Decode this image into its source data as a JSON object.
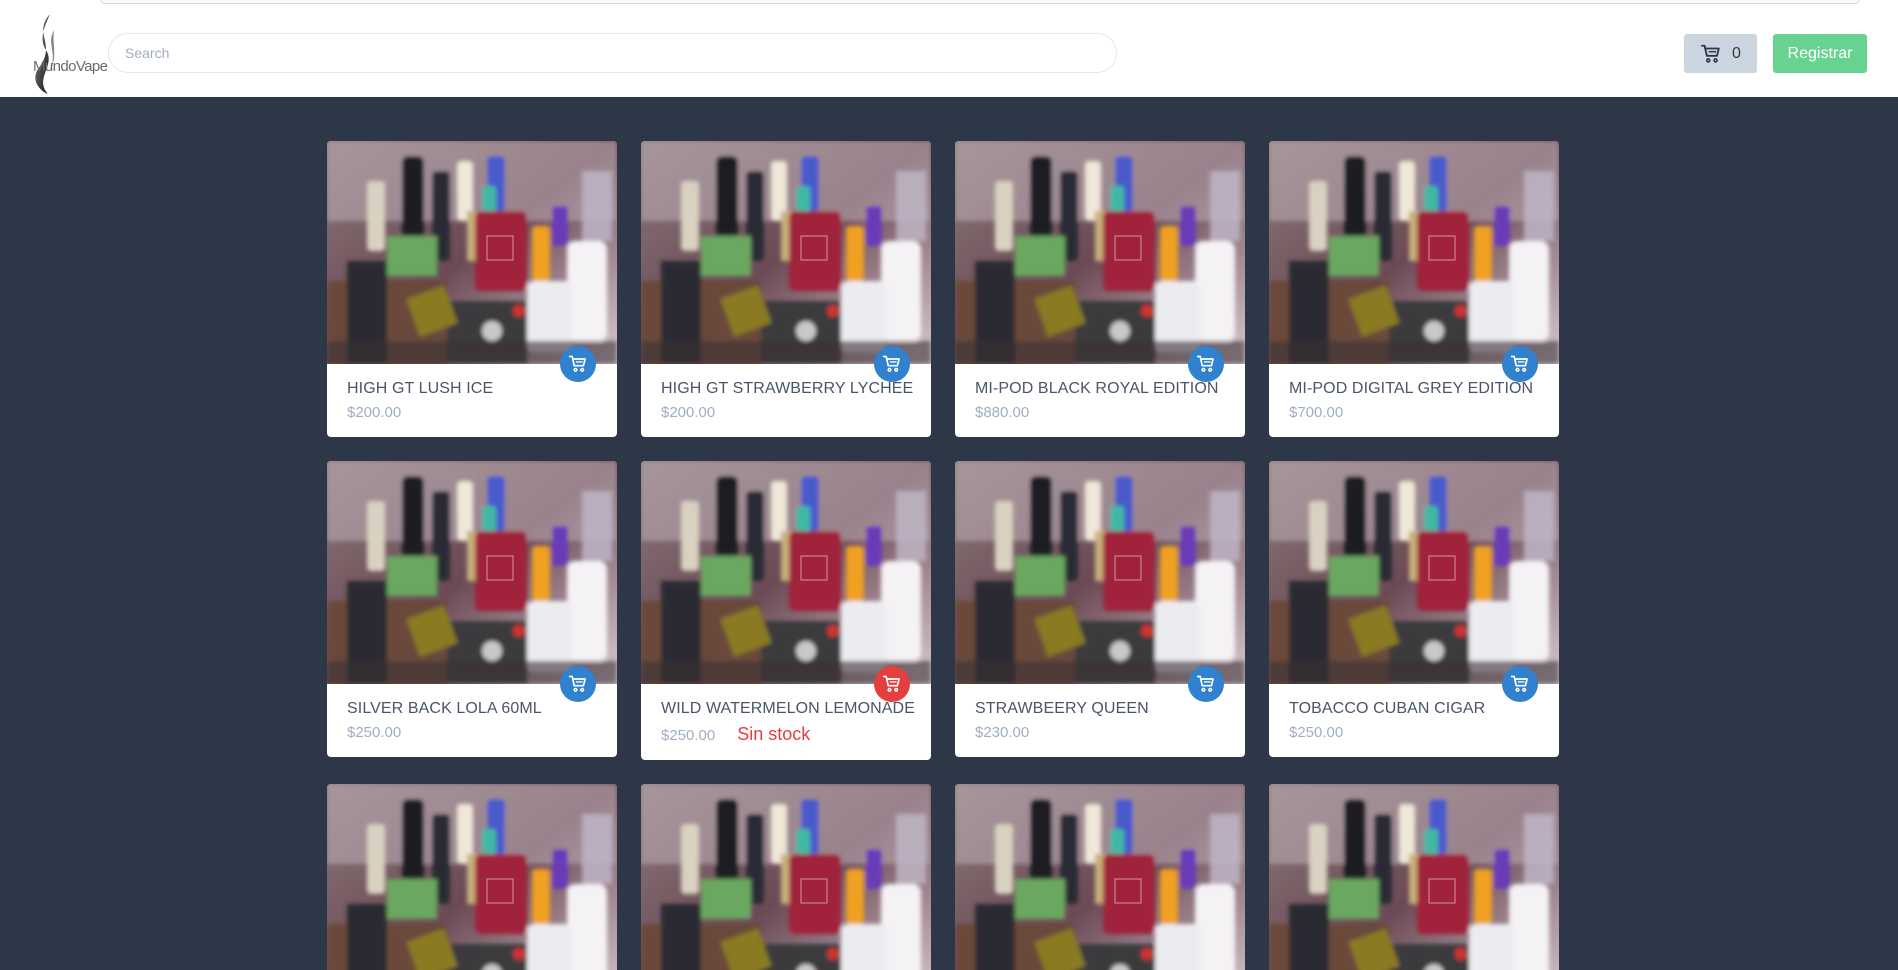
{
  "header": {
    "logo_text": "MundoVape",
    "search_placeholder": "Search",
    "cart_count": "0",
    "register_label": "Registrar"
  },
  "products": [
    {
      "name": "HIGH GT LUSH ICE",
      "price": "$200.00",
      "in_stock": true
    },
    {
      "name": "HIGH GT STRAWBERRY LYCHEE",
      "price": "$200.00",
      "in_stock": true
    },
    {
      "name": "MI-POD BLACK ROYAL EDITION",
      "price": "$880.00",
      "in_stock": true
    },
    {
      "name": "MI-POD DIGITAL GREY EDITION",
      "price": "$700.00",
      "in_stock": true
    },
    {
      "name": "SILVER BACK LOLA 60ML",
      "price": "$250.00",
      "in_stock": true
    },
    {
      "name": "WILD WATERMELON LEMONADE",
      "price": "$250.00",
      "in_stock": false,
      "stock_label": "Sin stock"
    },
    {
      "name": "STRAWBEERY QUEEN",
      "price": "$230.00",
      "in_stock": true
    },
    {
      "name": "TOBACCO CUBAN CIGAR",
      "price": "$250.00",
      "in_stock": true
    }
  ],
  "colors": {
    "page_bg": "#2d3748",
    "cart_button_bg": "#cbd5e0",
    "register_bg": "#68d391",
    "add_to_cart": "#3182ce",
    "out_of_stock": "#e53e3e"
  },
  "icons": {
    "cart": "shopping-cart-icon",
    "logo": "smoke-plume-logo"
  }
}
